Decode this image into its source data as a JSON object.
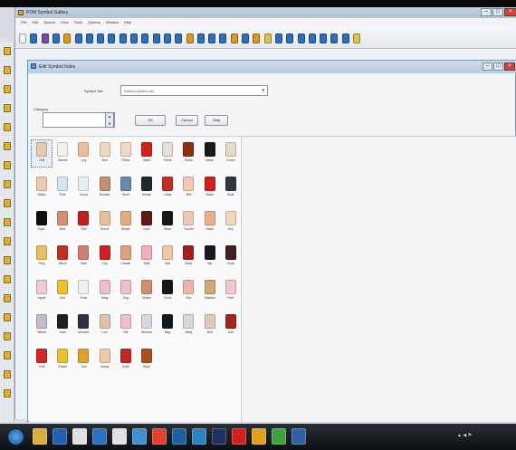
{
  "app": {
    "title": "PDM Symbol Gallery",
    "menu": [
      "File",
      "Edit",
      "Search",
      "View",
      "Tools",
      "Options",
      "Window",
      "Help"
    ],
    "window_buttons": {
      "minimize": "–",
      "maximize": "□",
      "close": "×"
    }
  },
  "toolbar": {
    "icons": [
      {
        "name": "new-icon",
        "color": "#f5f5f5"
      },
      {
        "name": "open-icon",
        "color": "#2f6fba"
      },
      {
        "name": "save-icon",
        "color": "#7a4aa8"
      },
      {
        "name": "search-icon",
        "color": "#2f6fba"
      },
      {
        "name": "pencil-icon",
        "color": "#d99b20"
      },
      {
        "name": "question-icon",
        "color": "#2f6fba"
      },
      {
        "name": "shape-icon",
        "color": "#2f6fba"
      },
      {
        "name": "grid-icon",
        "color": "#2f6fba"
      },
      {
        "name": "grid-icon",
        "color": "#2f6fba"
      },
      {
        "name": "grid-icon",
        "color": "#2f6fba"
      },
      {
        "name": "grid-icon",
        "color": "#2f6fba"
      },
      {
        "name": "grid-icon",
        "color": "#2f6fba"
      },
      {
        "name": "grid-icon",
        "color": "#2f6fba"
      },
      {
        "name": "grid-icon",
        "color": "#2f6fba"
      },
      {
        "name": "grid-icon",
        "color": "#2f6fba"
      },
      {
        "name": "figure-icon",
        "color": "#d99b20"
      },
      {
        "name": "figure-icon",
        "color": "#2f6fba"
      },
      {
        "name": "figure-icon",
        "color": "#2f6fba"
      },
      {
        "name": "figure-icon",
        "color": "#2f6fba"
      },
      {
        "name": "figure-icon",
        "color": "#d99b20"
      },
      {
        "name": "figure-icon",
        "color": "#2f6fba"
      },
      {
        "name": "folder-icon",
        "color": "#d99b20"
      },
      {
        "name": "figure-icon",
        "color": "#e0c24a"
      },
      {
        "name": "figure-icon",
        "color": "#2f6fba"
      },
      {
        "name": "figure-icon",
        "color": "#2f6fba"
      },
      {
        "name": "figure-icon",
        "color": "#2f6fba"
      },
      {
        "name": "figure-icon",
        "color": "#2f6fba"
      },
      {
        "name": "figure-icon",
        "color": "#2f6fba"
      },
      {
        "name": "figure-icon",
        "color": "#2f6fba"
      },
      {
        "name": "figure-icon",
        "color": "#2f6fba"
      },
      {
        "name": "figure-icon",
        "color": "#e0c24a"
      }
    ]
  },
  "dialog": {
    "title": "Edit Symbol Index",
    "select_label": "Symbol Set",
    "select_value": "Default symbol set",
    "group_label": "Category",
    "group_value": "",
    "ok_label": "OK",
    "cancel_label": "Cancel",
    "help_label": "Help"
  },
  "symbols": [
    {
      "label": "Cliff",
      "color": "#e8c8b0"
    },
    {
      "label": "Sheets",
      "color": "#f0f0f0"
    },
    {
      "label": "Leg",
      "color": "#e8c0a0"
    },
    {
      "label": "Bed",
      "color": "#f0d8c0"
    },
    {
      "label": "Pillow",
      "color": "#f0d8c8"
    },
    {
      "label": "Heart",
      "color": "#d02020"
    },
    {
      "label": "Pants",
      "color": "#e8e0d8"
    },
    {
      "label": "Dress",
      "color": "#8a3010"
    },
    {
      "label": "Mask",
      "color": "#201818"
    },
    {
      "label": "Crown",
      "color": "#e8d8c8"
    },
    {
      "label": "Glass",
      "color": "#f0c8b0"
    },
    {
      "label": "Pole",
      "color": "#d8e4ee"
    },
    {
      "label": "Cloud",
      "color": "#e8eef6"
    },
    {
      "label": "Rooster",
      "color": "#c09070"
    },
    {
      "label": "Shell",
      "color": "#6a8ab0"
    },
    {
      "label": "Mouse",
      "color": "#202830"
    },
    {
      "label": "Lamp",
      "color": "#c03028"
    },
    {
      "label": "Bell",
      "color": "#f0c8b8"
    },
    {
      "label": "Swan",
      "color": "#d02020"
    },
    {
      "label": "Boat",
      "color": "#303848"
    },
    {
      "label": "Eyes",
      "color": "#101010"
    },
    {
      "label": "Bird",
      "color": "#d09070"
    },
    {
      "label": "Tree",
      "color": "#c02020"
    },
    {
      "label": "Pencil",
      "color": "#e8c0a0"
    },
    {
      "label": "Bread",
      "color": "#e0b080"
    },
    {
      "label": "Door",
      "color": "#601818"
    },
    {
      "label": "Shoe",
      "color": "#181818"
    },
    {
      "label": "Tunnel",
      "color": "#f0c8c0"
    },
    {
      "label": "Hand",
      "color": "#e8b090"
    },
    {
      "label": "Key",
      "color": "#f0d8c0"
    },
    {
      "label": "Ring",
      "color": "#e8c060"
    },
    {
      "label": "Mirror",
      "color": "#c03020"
    },
    {
      "label": "Stair",
      "color": "#d08070"
    },
    {
      "label": "Cup",
      "color": "#d02020"
    },
    {
      "label": "Candle",
      "color": "#e0a080"
    },
    {
      "label": "Wall",
      "color": "#f0b0b8"
    },
    {
      "label": "Star",
      "color": "#f0c8a8"
    },
    {
      "label": "Book",
      "color": "#a02020"
    },
    {
      "label": "Hat",
      "color": "#181820"
    },
    {
      "label": "Chair",
      "color": "#402020"
    },
    {
      "label": "Apple",
      "color": "#f0c8d8"
    },
    {
      "label": "Sun",
      "color": "#e8c030"
    },
    {
      "label": "Rock",
      "color": "#f0f0f0"
    },
    {
      "label": "Wing",
      "color": "#f0c0c8"
    },
    {
      "label": "Dog",
      "color": "#f0c0c8"
    },
    {
      "label": "Snake",
      "color": "#d09070"
    },
    {
      "label": "Clock",
      "color": "#181818"
    },
    {
      "label": "Box",
      "color": "#e8b8b0"
    },
    {
      "label": "Shadow",
      "color": "#d0a878"
    },
    {
      "label": "Path",
      "color": "#f0c8c8"
    },
    {
      "label": "Wheel",
      "color": "#c8b8d0"
    },
    {
      "label": "Gate",
      "color": "#202020"
    },
    {
      "label": "Monster",
      "color": "#303040"
    },
    {
      "label": "Lion",
      "color": "#e0c0b0"
    },
    {
      "label": "Gift",
      "color": "#f0c0c8"
    },
    {
      "label": "Window",
      "color": "#d8d8e0"
    },
    {
      "label": "Bag",
      "color": "#101820"
    },
    {
      "label": "Baby",
      "color": "#d8d8e0"
    },
    {
      "label": "Bird",
      "color": "#e0c8c0"
    },
    {
      "label": "Doll",
      "color": "#a02820"
    },
    {
      "label": "Fruit",
      "color": "#d02828"
    },
    {
      "label": "Flower",
      "color": "#e8c030"
    },
    {
      "label": "Tool",
      "color": "#e0a030"
    },
    {
      "label": "Candy",
      "color": "#f0c8b0"
    },
    {
      "label": "Knife",
      "color": "#c02828"
    },
    {
      "label": "Rope",
      "color": "#a85020"
    }
  ],
  "left_toolbar": {
    "count": 19
  },
  "taskbar": {
    "start": "start-orb",
    "apps": [
      {
        "name": "explorer-task",
        "color": "#d8b040"
      },
      {
        "name": "media-task",
        "color": "#2060b0"
      },
      {
        "name": "app-task",
        "color": "#e0e0e0"
      },
      {
        "name": "mail-task",
        "color": "#3070c0"
      },
      {
        "name": "tool-task",
        "color": "#e0e0e0"
      },
      {
        "name": "app-task",
        "color": "#4090d0"
      },
      {
        "name": "chrome-task",
        "color": "#e04030"
      },
      {
        "name": "app-task",
        "color": "#2060a0"
      },
      {
        "name": "app-task",
        "color": "#3080c0"
      },
      {
        "name": "app-task",
        "color": "#203060"
      },
      {
        "name": "app-task",
        "color": "#d02020"
      },
      {
        "name": "app-task",
        "color": "#e0a020"
      },
      {
        "name": "app-task",
        "color": "#40a040"
      },
      {
        "name": "app-task",
        "color": "#3060a0"
      }
    ],
    "tray_text": "▲ ◀ ⚑"
  }
}
